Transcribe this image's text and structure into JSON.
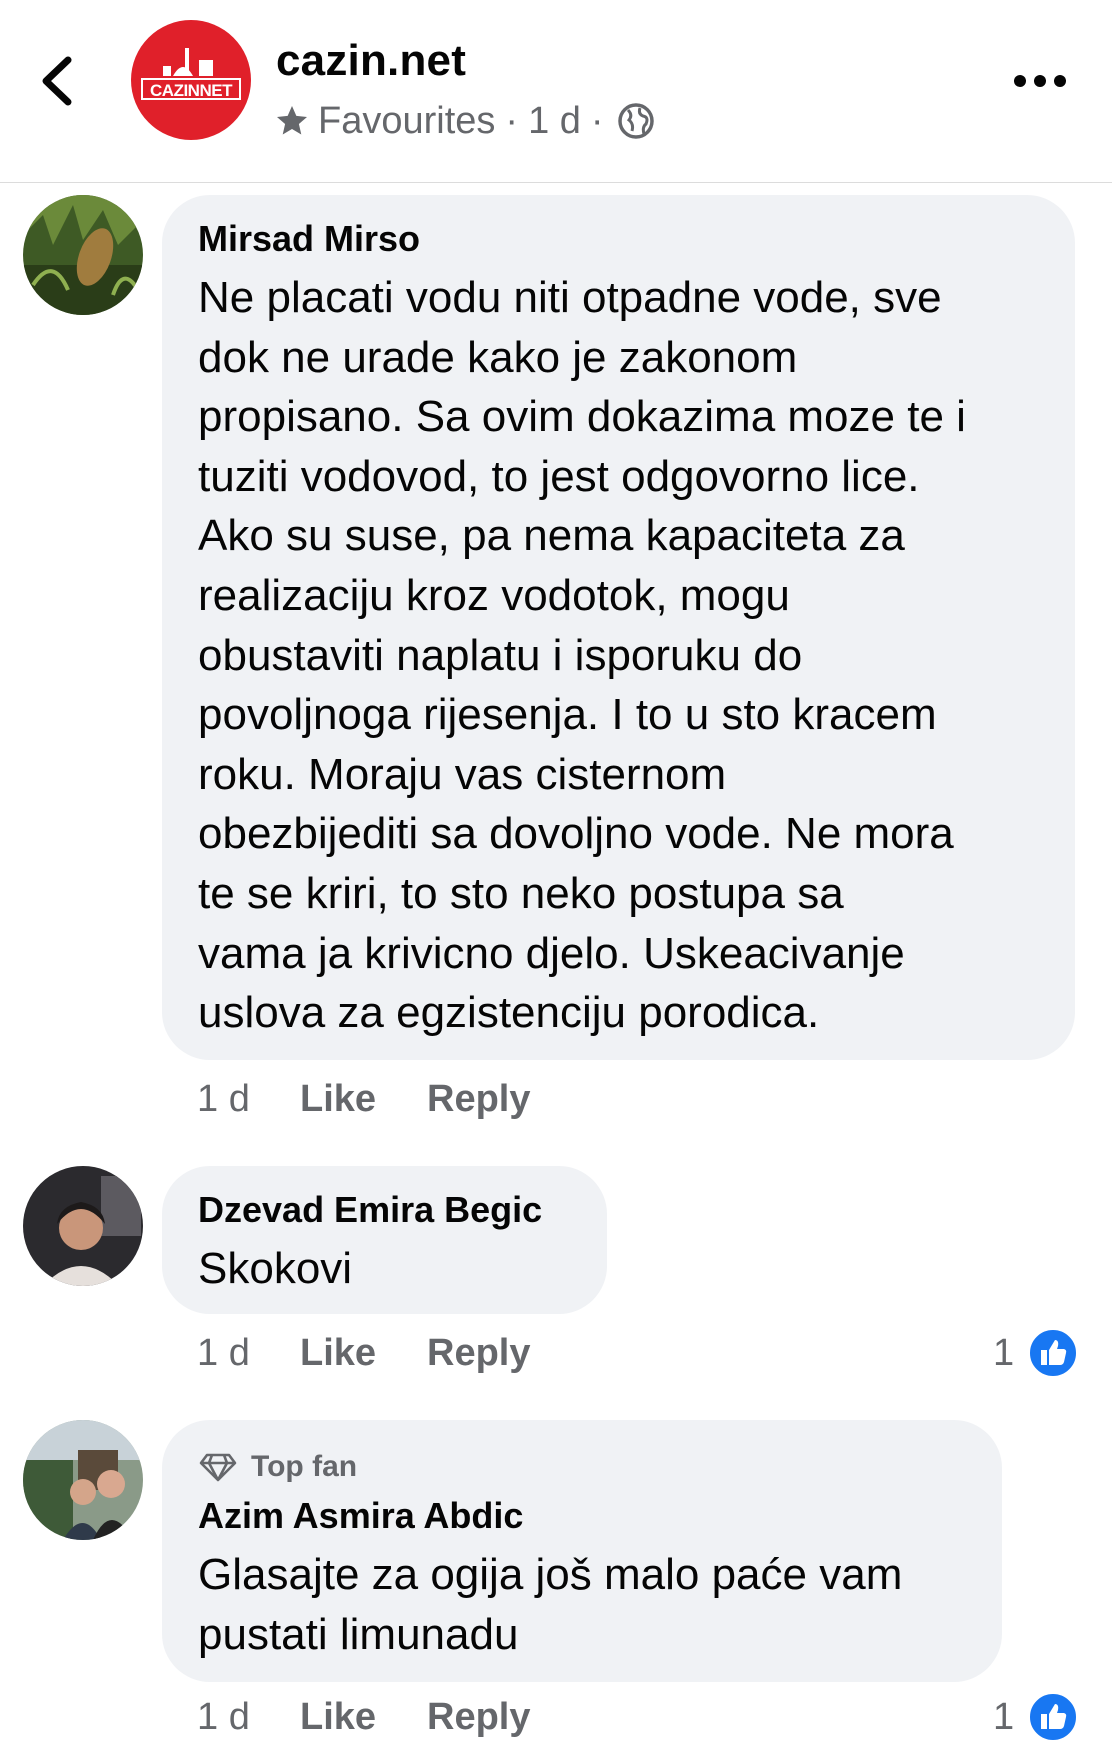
{
  "header": {
    "page_name": "cazin.net",
    "logo_text": "CAZINNET",
    "favourites_label": "Favourites",
    "time": "1 d",
    "separator": "·"
  },
  "comments": [
    {
      "author": "Mirsad Mirso",
      "text": "Ne placati vodu niti otpadne vode, sve\ndok ne urade kako je zakonom\npropisano. Sa ovim dokazima moze te i\ntuziti vodovod, to jest odgovorno lice.\nAko su suse, pa nema kapaciteta za\nrealizaciju kroz vodotok, mogu\nobustaviti naplatu i isporuku do\npovoljnoga rijesenja. I to u sto kracem\nroku. Moraju vas cisternom\nobezbijediti sa dovoljno vode. Ne mora\nte se kriri, to sto neko postupa sa\nvama ja krivicno djelo. Uskeacivanje\nuslova za egzistenciju porodica.",
      "time": "1 d",
      "like": "Like",
      "reply": "Reply"
    },
    {
      "author": "Dzevad Emira Begic",
      "text": "Skokovi",
      "time": "1 d",
      "like": "Like",
      "reply": "Reply",
      "reaction_count": "1"
    },
    {
      "badge": "Top fan",
      "author": "Azim Asmira Abdic",
      "text": "Glasajte za ogija još malo paće vam\npustati limunadu",
      "time": "1 d",
      "like": "Like",
      "reply": "Reply",
      "reaction_count": "1"
    }
  ],
  "colors": {
    "brand_red": "#e0202a",
    "like_blue": "#1877f2",
    "bubble_bg": "#f0f2f5",
    "secondary_text": "#65676b"
  }
}
